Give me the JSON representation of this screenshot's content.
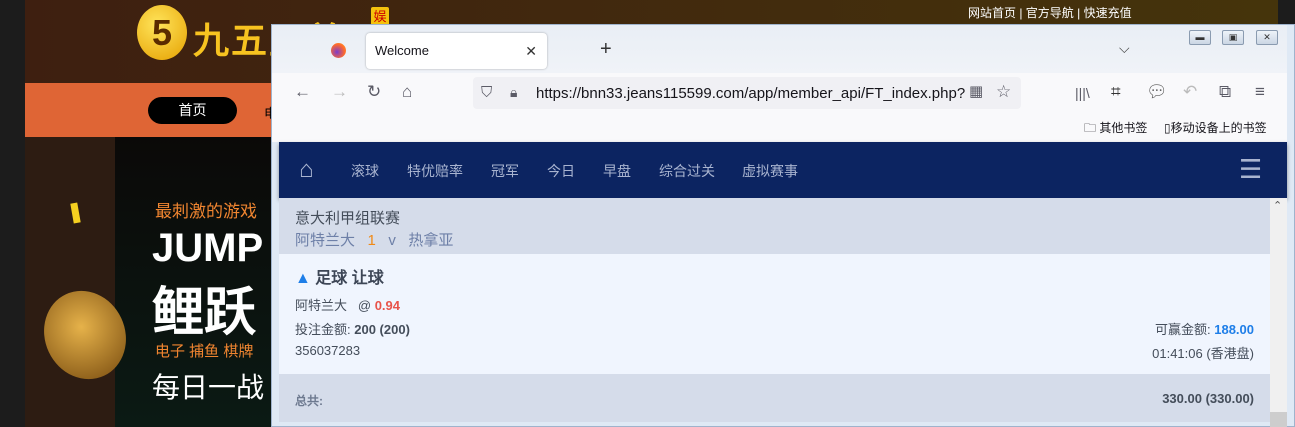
{
  "site": {
    "logo_text": "九五至尊",
    "logo_badge": "娱",
    "top_links": "网站首页 | 官方导航 | 快速充值",
    "nav_home": "首页",
    "nav_next": "电",
    "banner": {
      "line1": "最刺激的游戏",
      "line2": "JUMP U",
      "line3": "鲤跃",
      "line4": "电子  捕鱼  棋牌",
      "line5": "每日一战"
    }
  },
  "browser": {
    "tab_title": "Welcome",
    "url": "https://bnn33.jeans115599.com/app/member_api/FT_index.php?",
    "bookmarks": {
      "other": "其他书签",
      "mobile": "移动设备上的书签"
    }
  },
  "page": {
    "nav": [
      "滚球",
      "特优赔率",
      "冠军",
      "今日",
      "早盘",
      "综合过关",
      "虚拟赛事"
    ],
    "league": "意大利甲组联赛",
    "home_team": "阿特兰大",
    "handicap": "1",
    "vs": "v",
    "away_team": "热拿亚",
    "bet_title": "足球 让球",
    "pick": "阿特兰大",
    "at": "@",
    "odds": "0.94",
    "stake_label": "投注金额:",
    "stake_value": "200 (200)",
    "win_label": "可赢金额:",
    "win_value": "188.00",
    "ticket_id": "356037283",
    "time": "01:41:06 (香港盘)",
    "total_label": "总共:",
    "total_value": "330.00 (330.00)"
  },
  "colors": {
    "nav_bg": "#0c2461",
    "odds": "#e8534a",
    "win": "#1e7ee8",
    "handicap": "#f08a18"
  }
}
